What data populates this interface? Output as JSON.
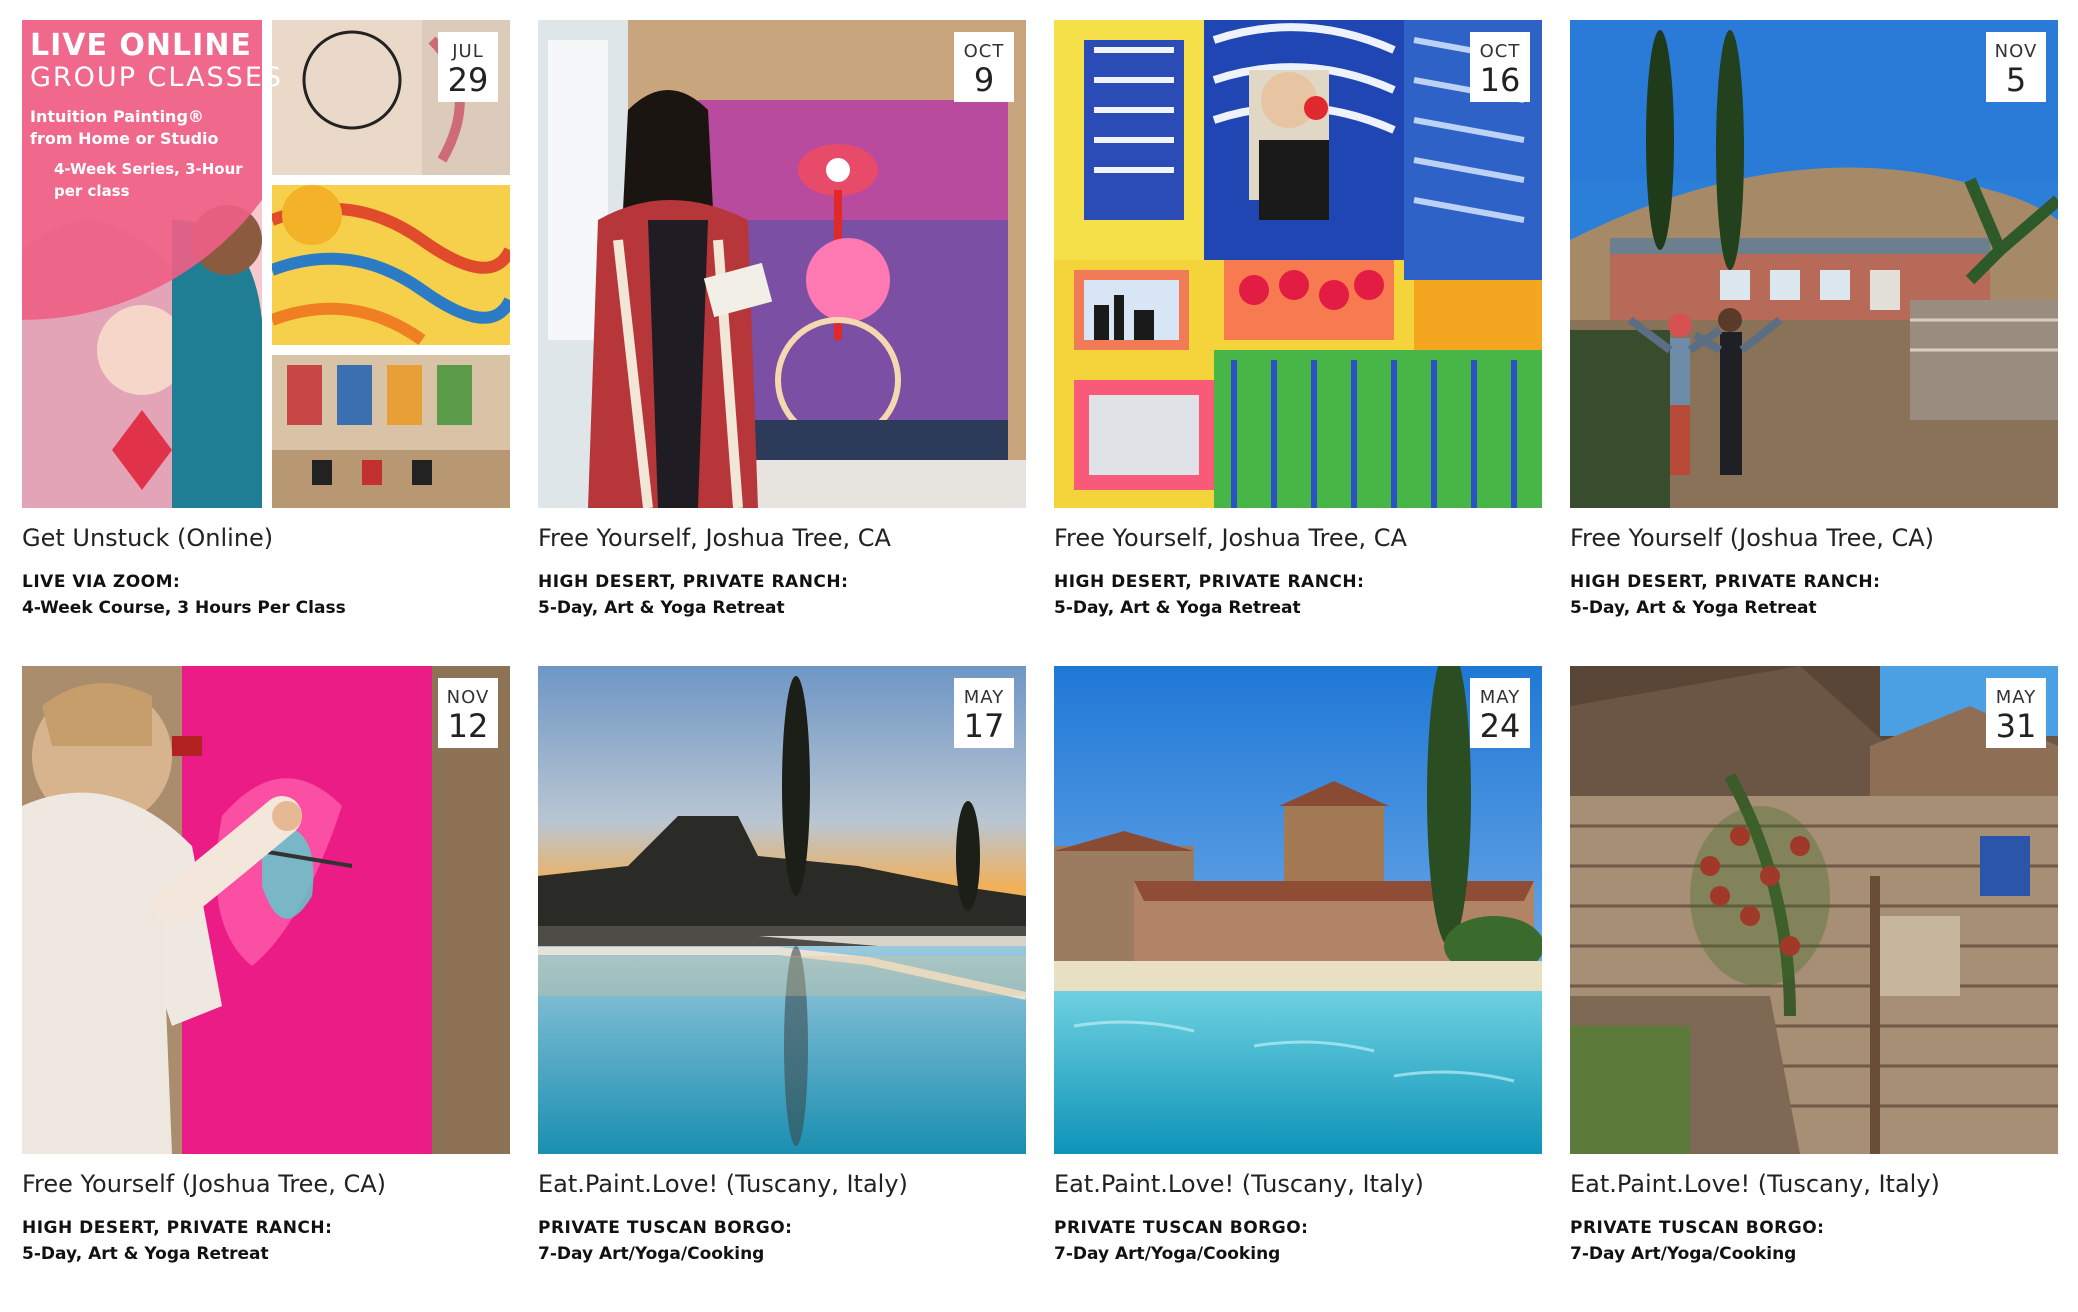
{
  "events": [
    {
      "month": "JUL",
      "day": "29",
      "title": "Get Unstuck (Online)",
      "subtitle_line1": "LIVE VIA ZOOM:",
      "subtitle_line2": "4-Week Course, 3 Hours Per Class",
      "image": "collage-painting-classes",
      "promo": {
        "line1": "LIVE ONLINE",
        "line2": "GROUP CLASSES",
        "line3": "Intuition Painting® from Home or Studio",
        "line4": "4-Week Series, 3-Hour per class"
      }
    },
    {
      "month": "OCT",
      "day": "9",
      "title": "Free Yourself, Joshua Tree, CA",
      "subtitle_line1": "HIGH DESERT, PRIVATE RANCH:",
      "subtitle_line2": "5-Day, Art & Yoga Retreat",
      "image": "woman-with-painting"
    },
    {
      "month": "OCT",
      "day": "16",
      "title": "Free Yourself, Joshua Tree, CA",
      "subtitle_line1": "HIGH DESERT, PRIVATE RANCH:",
      "subtitle_line2": "5-Day, Art & Yoga Retreat",
      "image": "colorful-painting"
    },
    {
      "month": "NOV",
      "day": "5",
      "title": "Free Yourself (Joshua Tree, CA)",
      "subtitle_line1": "HIGH DESERT, PRIVATE RANCH:",
      "subtitle_line2": "5-Day, Art & Yoga Retreat",
      "image": "desert-ranch"
    },
    {
      "month": "NOV",
      "day": "12",
      "title": "Free Yourself (Joshua Tree, CA)",
      "subtitle_line1": "HIGH DESERT, PRIVATE RANCH:",
      "subtitle_line2": "5-Day, Art & Yoga Retreat",
      "image": "woman-painting-pink"
    },
    {
      "month": "MAY",
      "day": "17",
      "title": "Eat.Paint.Love! (Tuscany, Italy)",
      "subtitle_line1": "PRIVATE TUSCAN BORGO:",
      "subtitle_line2": "7-Day Art/Yoga/Cooking",
      "image": "tuscan-pool-sunset"
    },
    {
      "month": "MAY",
      "day": "24",
      "title": "Eat.Paint.Love! (Tuscany, Italy)",
      "subtitle_line1": "PRIVATE TUSCAN BORGO:",
      "subtitle_line2": "7-Day Art/Yoga/Cooking",
      "image": "tuscan-pool-day"
    },
    {
      "month": "MAY",
      "day": "31",
      "title": "Eat.Paint.Love! (Tuscany, Italy)",
      "subtitle_line1": "PRIVATE TUSCAN BORGO:",
      "subtitle_line2": "7-Day Art/Yoga/Cooking",
      "image": "stone-house-roses"
    }
  ]
}
